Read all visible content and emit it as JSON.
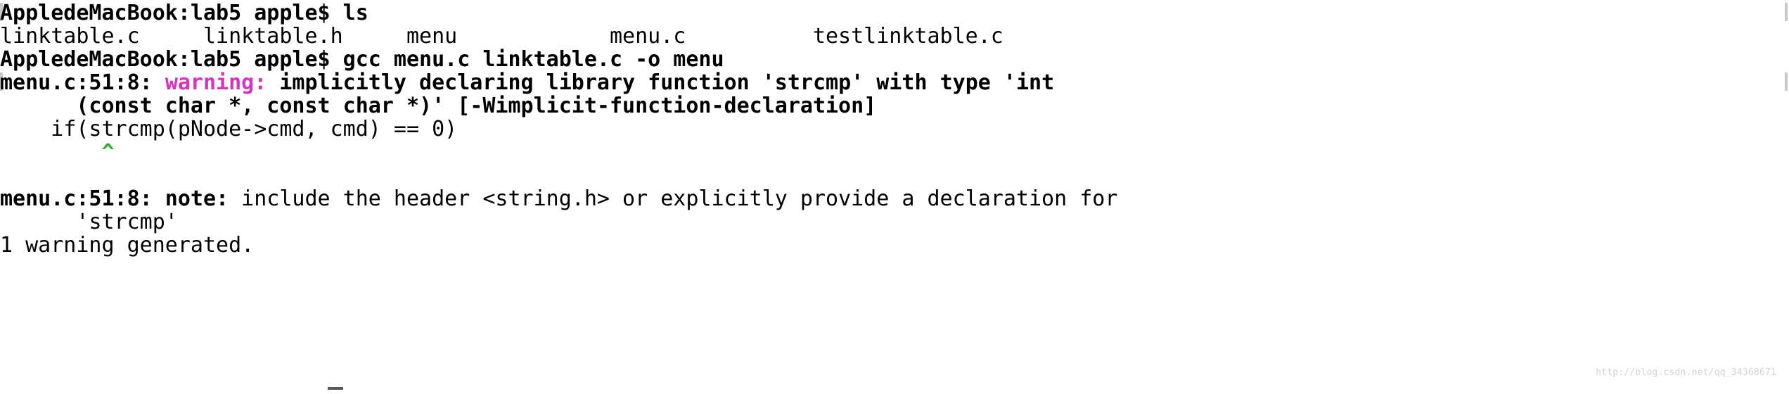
{
  "terminal": {
    "background_color": "#ffffff",
    "foreground_color": "#000000",
    "warning_color": "#d633c0",
    "caret_color": "#2cb42c",
    "prompt_user": "AppledeMacBook:lab5 apple$",
    "lines": [
      {
        "id": "line-1-prompt-ls",
        "segments": [
          {
            "text": "AppledeMacBook:lab5 apple$ ls",
            "style": "bold"
          }
        ]
      },
      {
        "id": "line-2-file-listing",
        "segments": [
          {
            "text": "linktable.c     linktable.h     menu            menu.c          testlinktable.c",
            "style": "reg"
          }
        ]
      },
      {
        "id": "line-3-prompt-gcc",
        "segments": [
          {
            "text": "AppledeMacBook:lab5 apple$ gcc menu.c linktable.c -o menu",
            "style": "bold"
          }
        ]
      },
      {
        "id": "line-4-warning",
        "segments": [
          {
            "text": "menu.c:51:8: ",
            "style": "bold"
          },
          {
            "text": "warning:",
            "style": "warn"
          },
          {
            "text": " implicitly declaring library function 'strcmp' with type 'int",
            "style": "bold"
          }
        ]
      },
      {
        "id": "line-5-warning-cont",
        "segments": [
          {
            "text": "      (const char *, const char *)' [-Wimplicit-function-declaration]",
            "style": "bold"
          }
        ]
      },
      {
        "id": "line-6-source-snippet",
        "segments": [
          {
            "text": "    if(strcmp(pNode->cmd, cmd) == 0)",
            "style": "reg"
          }
        ]
      },
      {
        "id": "line-7-caret",
        "segments": [
          {
            "text": "        ",
            "style": "reg"
          },
          {
            "text": "^",
            "style": "caret"
          }
        ]
      },
      {
        "id": "line-8-blank",
        "segments": [
          {
            "text": " ",
            "style": "reg"
          }
        ]
      },
      {
        "id": "line-9-note",
        "segments": [
          {
            "text": "menu.c:51:8: note:",
            "style": "bold"
          },
          {
            "text": " include the header <string.h> or explicitly provide a declaration for",
            "style": "reg"
          }
        ]
      },
      {
        "id": "line-10-note-cont",
        "segments": [
          {
            "text": "      'strcmp'",
            "style": "reg"
          }
        ]
      },
      {
        "id": "line-11-summary",
        "segments": [
          {
            "text": "1 warning generated.",
            "style": "reg"
          }
        ]
      }
    ]
  },
  "watermark": {
    "text": "http://blog.csdn.net/qq_34368671"
  },
  "cursor": {
    "visible": true
  }
}
